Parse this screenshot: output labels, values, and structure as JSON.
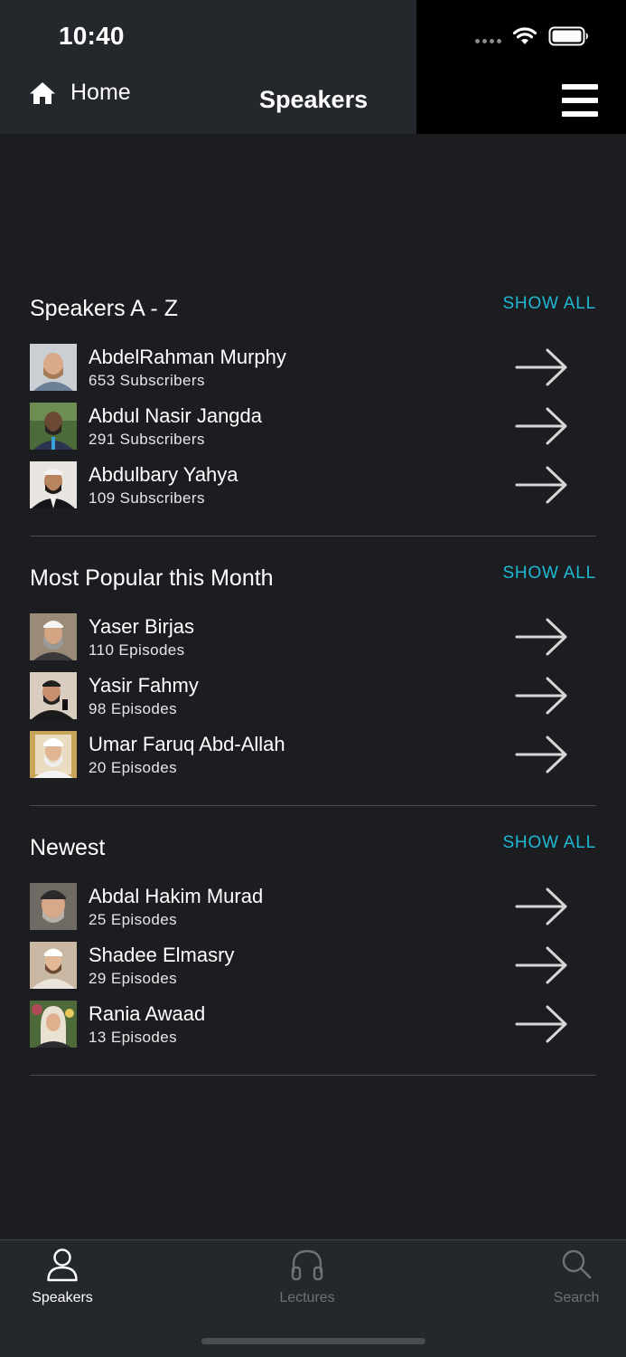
{
  "status_bar": {
    "time": "10:40"
  },
  "header": {
    "home_label": "Home",
    "title": "Speakers"
  },
  "sections": [
    {
      "title": "Speakers A - Z",
      "show_all": "SHOW ALL",
      "items": [
        {
          "name": "AbdelRahman Murphy",
          "subtitle": "653 Subscribers"
        },
        {
          "name": "Abdul Nasir Jangda",
          "subtitle": "291 Subscribers"
        },
        {
          "name": "Abdulbary Yahya",
          "subtitle": "109 Subscribers"
        }
      ]
    },
    {
      "title": "Most Popular this Month",
      "show_all": "SHOW ALL",
      "items": [
        {
          "name": "Yaser Birjas",
          "subtitle": "110 Episodes"
        },
        {
          "name": "Yasir Fahmy",
          "subtitle": "98 Episodes"
        },
        {
          "name": "Umar Faruq Abd-Allah",
          "subtitle": "20 Episodes"
        }
      ]
    },
    {
      "title": "Newest",
      "show_all": "SHOW ALL",
      "items": [
        {
          "name": "Abdal Hakim Murad",
          "subtitle": "25 Episodes"
        },
        {
          "name": "Shadee Elmasry",
          "subtitle": "29 Episodes"
        },
        {
          "name": "Rania Awaad",
          "subtitle": "13 Episodes"
        }
      ]
    }
  ],
  "tabbar": {
    "tabs": [
      {
        "label": "Speakers",
        "icon": "person-icon",
        "active": true
      },
      {
        "label": "Lectures",
        "icon": "headphones-icon",
        "active": false
      },
      {
        "label": "Search",
        "icon": "search-icon",
        "active": false
      }
    ]
  },
  "colors": {
    "background": "#1b1d21",
    "header": "#24272b",
    "accent": "#1fb8d4",
    "inactive_tab": "#6e7176"
  }
}
